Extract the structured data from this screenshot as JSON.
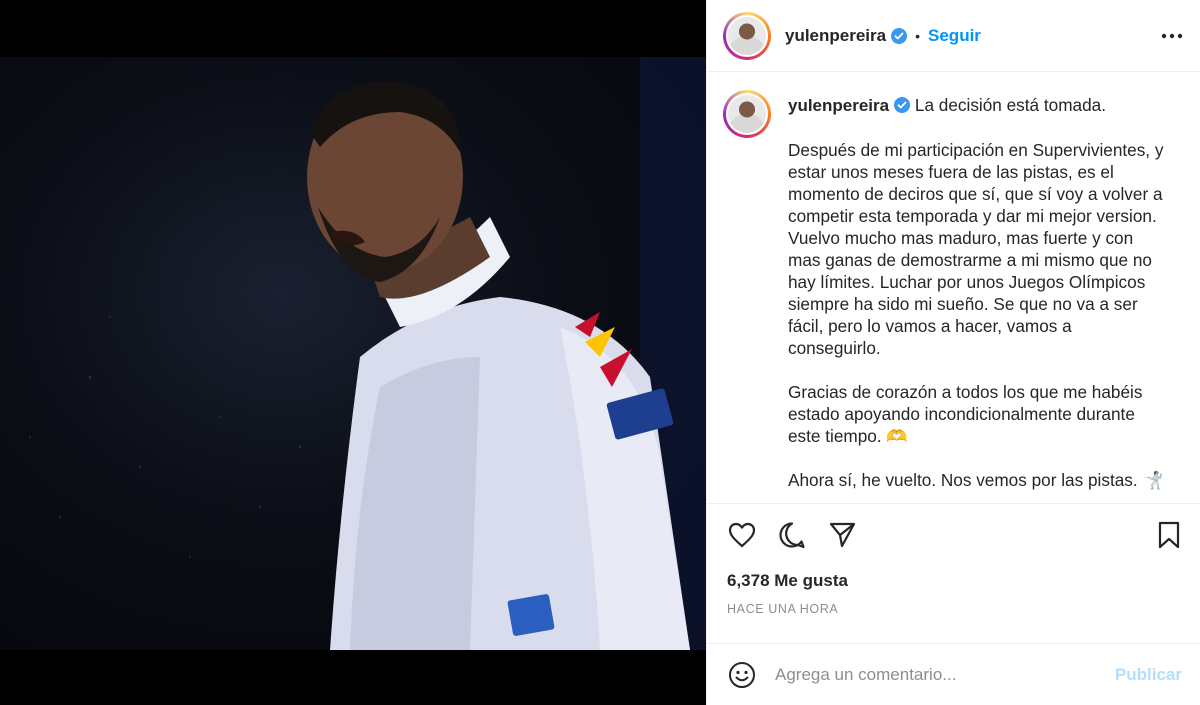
{
  "post": {
    "username": "yulenpereira",
    "follow_label": "Seguir",
    "separator": "•"
  },
  "caption": {
    "username": "yulenpereira",
    "first_line": "La decisión está tomada.",
    "paragraphs": [
      "Después de mi participación en Supervivientes, y estar unos meses fuera de las pistas, es el momento de deciros que sí, que sí voy a volver a competir esta temporada y dar mi mejor version. Vuelvo mucho mas maduro, mas fuerte y con mas ganas de demostrarme a mi mismo que no hay límites. Luchar por unos Juegos Olímpicos siempre ha sido mi sueño. Se que no va a ser fácil, pero lo vamos a hacer, vamos a conseguirlo.",
      "Gracias de corazón a todos los que me habéis estado apoyando incondicionalmente durante este tiempo. 🫶",
      "Ahora sí, he vuelto. Nos vemos por las pistas. 🤺"
    ]
  },
  "engagement": {
    "likes": "6,378 Me gusta",
    "time": "HACE UNA HORA"
  },
  "comment": {
    "placeholder": "Agrega un comentario...",
    "publish_label": "Publicar"
  },
  "icons": {
    "verified": "verified-badge-icon",
    "more": "more-options-icon",
    "like": "heart-icon",
    "comment": "comment-icon",
    "share": "paper-plane-icon",
    "save": "bookmark-icon",
    "emoji": "emoji-smiley-icon"
  },
  "colors": {
    "accent": "#0095f6",
    "verified": "#3897f0",
    "publish_disabled": "#b2dffc",
    "muted": "#8e8e8e",
    "text": "#262626"
  }
}
